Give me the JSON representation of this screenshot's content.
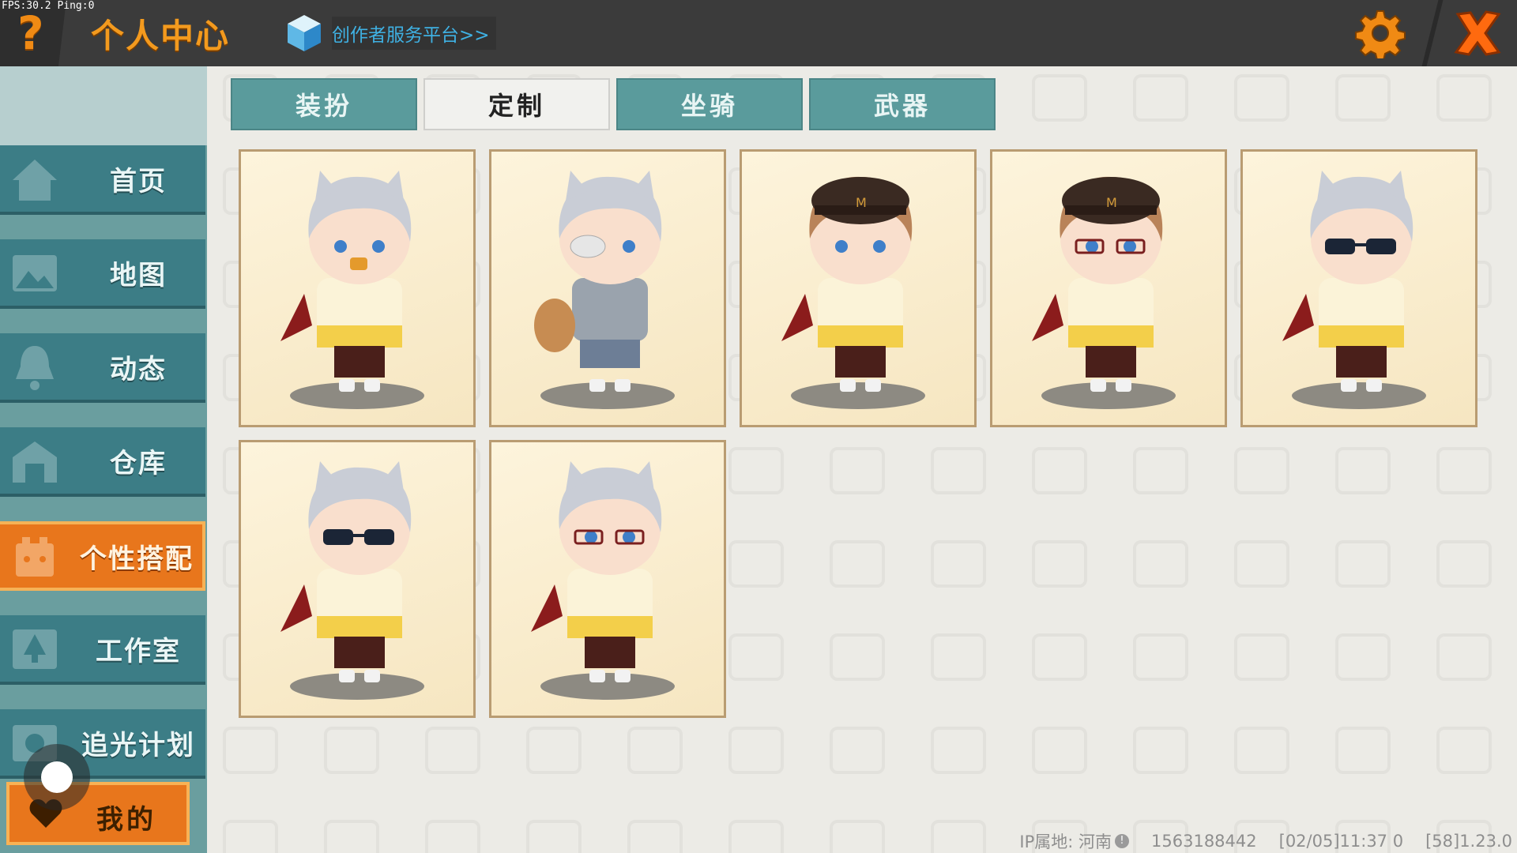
{
  "status": {
    "fps": "FPS:30.2",
    "ping": "Ping:0"
  },
  "header": {
    "help_glyph": "?",
    "title": "个人中心",
    "creator_link": "创作者服务平台>>",
    "icons": [
      "question-icon",
      "cube-icon",
      "gear-icon",
      "close-icon"
    ],
    "accent_color": "#f39a1e"
  },
  "sidebar": {
    "items": [
      {
        "label": "首页",
        "icon": "house-icon",
        "active": false
      },
      {
        "label": "地图",
        "icon": "picture-icon",
        "active": false
      },
      {
        "label": "动态",
        "icon": "bell-icon",
        "active": false
      },
      {
        "label": "仓库",
        "icon": "warehouse-icon",
        "active": false
      },
      {
        "label": "个性搭配",
        "icon": "character-icon",
        "active": true
      },
      {
        "label": "工作室",
        "icon": "tree-icon",
        "active": false
      },
      {
        "label": "追光计划",
        "icon": "spotlight-icon",
        "active": false
      }
    ],
    "me_label": "我的",
    "colors": {
      "item": "#3c7d86",
      "active": "#e8761c"
    }
  },
  "tabs": [
    {
      "label": "装扮",
      "active": false
    },
    {
      "label": "定制",
      "active": true
    },
    {
      "label": "坐骑",
      "active": false
    },
    {
      "label": "武器",
      "active": false
    }
  ],
  "outfits": [
    {
      "hair": "silver",
      "accessory": "mouth-charm",
      "outfit": "white-jacket"
    },
    {
      "hair": "silver",
      "accessory": "eyepatch",
      "outfit": "grey-sweater"
    },
    {
      "hair": "brown",
      "accessory": "black-cap",
      "outfit": "white-jacket"
    },
    {
      "hair": "brown",
      "accessory": "black-cap-glasses",
      "outfit": "white-jacket"
    },
    {
      "hair": "silver",
      "accessory": "sunglasses",
      "outfit": "white-jacket"
    },
    {
      "hair": "silver",
      "accessory": "sunglasses",
      "outfit": "white-jacket"
    },
    {
      "hair": "silver",
      "accessory": "glasses",
      "outfit": "white-jacket"
    }
  ],
  "footer": {
    "ip_location": "IP属地: 河南",
    "user_id": "1563188442",
    "timestamp": "[02/05]11:37 0",
    "version": "[58]1.23.0"
  }
}
